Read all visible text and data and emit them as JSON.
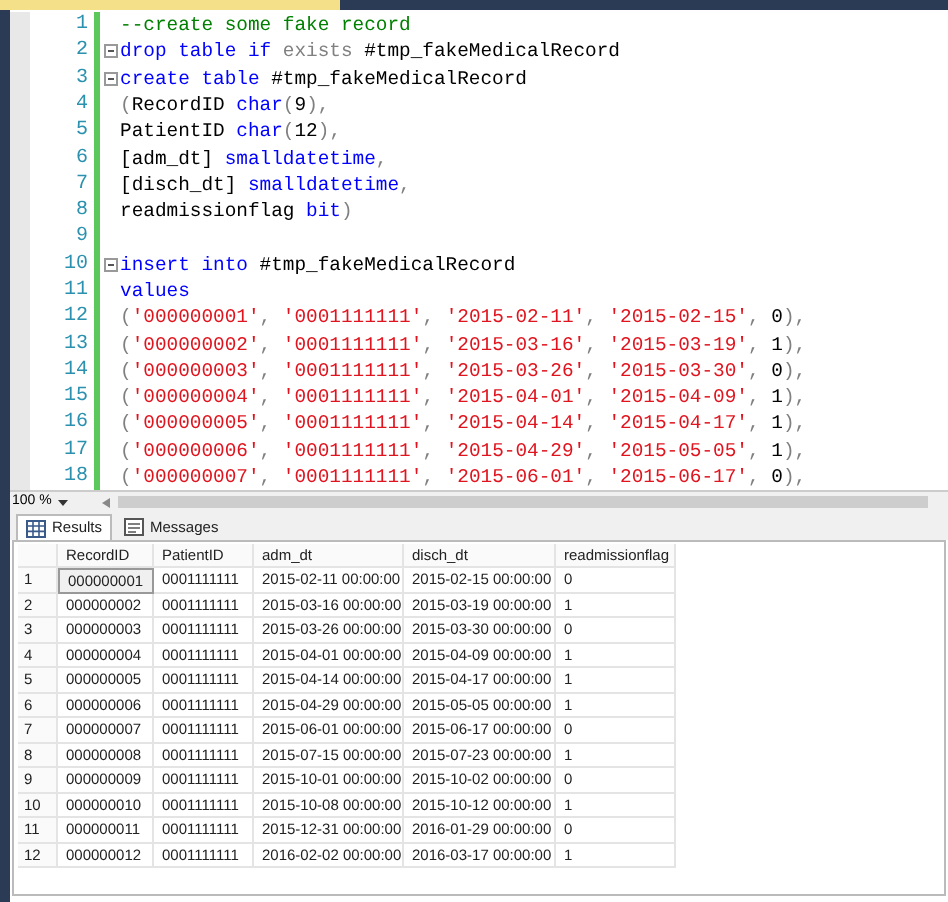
{
  "editor": {
    "lines": [
      {
        "number": "1",
        "collapsible": false,
        "tokens": [
          {
            "kind": "comment",
            "text": "--create some fake record"
          }
        ]
      },
      {
        "number": "2",
        "collapsible": true,
        "tokens": [
          {
            "kind": "keyword",
            "text": "drop table if "
          },
          {
            "kind": "gray",
            "text": "exists"
          },
          {
            "kind": "plain",
            "text": " #tmp_fakeMedicalRecord"
          }
        ]
      },
      {
        "number": "3",
        "collapsible": true,
        "tokens": [
          {
            "kind": "keyword",
            "text": "create table"
          },
          {
            "kind": "plain",
            "text": " #tmp_fakeMedicalRecord"
          }
        ]
      },
      {
        "number": "4",
        "collapsible": false,
        "tokens": [
          {
            "kind": "gray",
            "text": "("
          },
          {
            "kind": "plain",
            "text": "RecordID "
          },
          {
            "kind": "keyword",
            "text": "char"
          },
          {
            "kind": "gray",
            "text": "("
          },
          {
            "kind": "plain",
            "text": "9"
          },
          {
            "kind": "gray",
            "text": "),"
          }
        ]
      },
      {
        "number": "5",
        "collapsible": false,
        "tokens": [
          {
            "kind": "plain",
            "text": "PatientID "
          },
          {
            "kind": "keyword",
            "text": "char"
          },
          {
            "kind": "gray",
            "text": "("
          },
          {
            "kind": "plain",
            "text": "12"
          },
          {
            "kind": "gray",
            "text": "),"
          }
        ]
      },
      {
        "number": "6",
        "collapsible": false,
        "tokens": [
          {
            "kind": "plain",
            "text": "[adm_dt] "
          },
          {
            "kind": "keyword",
            "text": "smalldatetime"
          },
          {
            "kind": "gray",
            "text": ","
          }
        ]
      },
      {
        "number": "7",
        "collapsible": false,
        "tokens": [
          {
            "kind": "plain",
            "text": "[disch_dt] "
          },
          {
            "kind": "keyword",
            "text": "smalldatetime"
          },
          {
            "kind": "gray",
            "text": ","
          }
        ]
      },
      {
        "number": "8",
        "collapsible": false,
        "tokens": [
          {
            "kind": "plain",
            "text": "readmissionflag "
          },
          {
            "kind": "keyword",
            "text": "bit"
          },
          {
            "kind": "gray",
            "text": ")"
          }
        ]
      },
      {
        "number": "9",
        "collapsible": false
      },
      {
        "number": "10",
        "collapsible": true,
        "tokens": [
          {
            "kind": "keyword",
            "text": "insert into"
          },
          {
            "kind": "plain",
            "text": " #tmp_fakeMedicalRecord"
          }
        ]
      },
      {
        "number": "11",
        "collapsible": false,
        "tokens": [
          {
            "kind": "keyword",
            "text": "values"
          }
        ]
      },
      {
        "number": "12",
        "collapsible": false,
        "tokens": [
          {
            "kind": "gray",
            "text": "("
          },
          {
            "kind": "string",
            "text": "'000000001'"
          },
          {
            "kind": "gray",
            "text": ", "
          },
          {
            "kind": "string",
            "text": "'0001111111'"
          },
          {
            "kind": "gray",
            "text": ", "
          },
          {
            "kind": "string",
            "text": "'2015-02-11'"
          },
          {
            "kind": "gray",
            "text": ", "
          },
          {
            "kind": "string",
            "text": "'2015-02-15'"
          },
          {
            "kind": "gray",
            "text": ", "
          },
          {
            "kind": "plain",
            "text": "0"
          },
          {
            "kind": "gray",
            "text": "),"
          }
        ]
      },
      {
        "number": "13",
        "collapsible": false,
        "tokens": [
          {
            "kind": "gray",
            "text": "("
          },
          {
            "kind": "string",
            "text": "'000000002'"
          },
          {
            "kind": "gray",
            "text": ", "
          },
          {
            "kind": "string",
            "text": "'0001111111'"
          },
          {
            "kind": "gray",
            "text": ", "
          },
          {
            "kind": "string",
            "text": "'2015-03-16'"
          },
          {
            "kind": "gray",
            "text": ", "
          },
          {
            "kind": "string",
            "text": "'2015-03-19'"
          },
          {
            "kind": "gray",
            "text": ", "
          },
          {
            "kind": "plain",
            "text": "1"
          },
          {
            "kind": "gray",
            "text": "),"
          }
        ]
      },
      {
        "number": "14",
        "collapsible": false,
        "tokens": [
          {
            "kind": "gray",
            "text": "("
          },
          {
            "kind": "string",
            "text": "'000000003'"
          },
          {
            "kind": "gray",
            "text": ", "
          },
          {
            "kind": "string",
            "text": "'0001111111'"
          },
          {
            "kind": "gray",
            "text": ", "
          },
          {
            "kind": "string",
            "text": "'2015-03-26'"
          },
          {
            "kind": "gray",
            "text": ", "
          },
          {
            "kind": "string",
            "text": "'2015-03-30'"
          },
          {
            "kind": "gray",
            "text": ", "
          },
          {
            "kind": "plain",
            "text": "0"
          },
          {
            "kind": "gray",
            "text": "),"
          }
        ]
      },
      {
        "number": "15",
        "collapsible": false,
        "tokens": [
          {
            "kind": "gray",
            "text": "("
          },
          {
            "kind": "string",
            "text": "'000000004'"
          },
          {
            "kind": "gray",
            "text": ", "
          },
          {
            "kind": "string",
            "text": "'0001111111'"
          },
          {
            "kind": "gray",
            "text": ", "
          },
          {
            "kind": "string",
            "text": "'2015-04-01'"
          },
          {
            "kind": "gray",
            "text": ", "
          },
          {
            "kind": "string",
            "text": "'2015-04-09'"
          },
          {
            "kind": "gray",
            "text": ", "
          },
          {
            "kind": "plain",
            "text": "1"
          },
          {
            "kind": "gray",
            "text": "),"
          }
        ]
      },
      {
        "number": "16",
        "collapsible": false,
        "tokens": [
          {
            "kind": "gray",
            "text": "("
          },
          {
            "kind": "string",
            "text": "'000000005'"
          },
          {
            "kind": "gray",
            "text": ", "
          },
          {
            "kind": "string",
            "text": "'0001111111'"
          },
          {
            "kind": "gray",
            "text": ", "
          },
          {
            "kind": "string",
            "text": "'2015-04-14'"
          },
          {
            "kind": "gray",
            "text": ", "
          },
          {
            "kind": "string",
            "text": "'2015-04-17'"
          },
          {
            "kind": "gray",
            "text": ", "
          },
          {
            "kind": "plain",
            "text": "1"
          },
          {
            "kind": "gray",
            "text": "),"
          }
        ]
      },
      {
        "number": "17",
        "collapsible": false,
        "tokens": [
          {
            "kind": "gray",
            "text": "("
          },
          {
            "kind": "string",
            "text": "'000000006'"
          },
          {
            "kind": "gray",
            "text": ", "
          },
          {
            "kind": "string",
            "text": "'0001111111'"
          },
          {
            "kind": "gray",
            "text": ", "
          },
          {
            "kind": "string",
            "text": "'2015-04-29'"
          },
          {
            "kind": "gray",
            "text": ", "
          },
          {
            "kind": "string",
            "text": "'2015-05-05'"
          },
          {
            "kind": "gray",
            "text": ", "
          },
          {
            "kind": "plain",
            "text": "1"
          },
          {
            "kind": "gray",
            "text": "),"
          }
        ]
      },
      {
        "number": "18",
        "collapsible": false,
        "tokens": [
          {
            "kind": "gray",
            "text": "("
          },
          {
            "kind": "string",
            "text": "'000000007'"
          },
          {
            "kind": "gray",
            "text": ", "
          },
          {
            "kind": "string",
            "text": "'0001111111'"
          },
          {
            "kind": "gray",
            "text": ", "
          },
          {
            "kind": "string",
            "text": "'2015-06-01'"
          },
          {
            "kind": "gray",
            "text": ", "
          },
          {
            "kind": "string",
            "text": "'2015-06-17'"
          },
          {
            "kind": "gray",
            "text": ", "
          },
          {
            "kind": "plain",
            "text": "0"
          },
          {
            "kind": "gray",
            "text": "),"
          }
        ]
      }
    ]
  },
  "zoom": {
    "value": "100 %"
  },
  "result_tabs": [
    {
      "label": "Results",
      "kind": "grid",
      "selected": true
    },
    {
      "label": "Messages",
      "kind": "messages",
      "selected": false
    }
  ],
  "table": {
    "columns": [
      "RecordID",
      "PatientID",
      "adm_dt",
      "disch_dt",
      "readmissionflag"
    ],
    "rows": [
      {
        "number": "1",
        "selected": true,
        "cells": [
          "000000001",
          "0001111111",
          "2015-02-11 00:00:00",
          "2015-02-15 00:00:00",
          "0"
        ]
      },
      {
        "number": "2",
        "selected": false,
        "cells": [
          "000000002",
          "0001111111",
          "2015-03-16 00:00:00",
          "2015-03-19 00:00:00",
          "1"
        ]
      },
      {
        "number": "3",
        "selected": false,
        "cells": [
          "000000003",
          "0001111111",
          "2015-03-26 00:00:00",
          "2015-03-30 00:00:00",
          "0"
        ]
      },
      {
        "number": "4",
        "selected": false,
        "cells": [
          "000000004",
          "0001111111",
          "2015-04-01 00:00:00",
          "2015-04-09 00:00:00",
          "1"
        ]
      },
      {
        "number": "5",
        "selected": false,
        "cells": [
          "000000005",
          "0001111111",
          "2015-04-14 00:00:00",
          "2015-04-17 00:00:00",
          "1"
        ]
      },
      {
        "number": "6",
        "selected": false,
        "cells": [
          "000000006",
          "0001111111",
          "2015-04-29 00:00:00",
          "2015-05-05 00:00:00",
          "1"
        ]
      },
      {
        "number": "7",
        "selected": false,
        "cells": [
          "000000007",
          "0001111111",
          "2015-06-01 00:00:00",
          "2015-06-17 00:00:00",
          "0"
        ]
      },
      {
        "number": "8",
        "selected": false,
        "cells": [
          "000000008",
          "0001111111",
          "2015-07-15 00:00:00",
          "2015-07-23 00:00:00",
          "1"
        ]
      },
      {
        "number": "9",
        "selected": false,
        "cells": [
          "000000009",
          "0001111111",
          "2015-10-01 00:00:00",
          "2015-10-02 00:00:00",
          "0"
        ]
      },
      {
        "number": "10",
        "selected": false,
        "cells": [
          "000000010",
          "0001111111",
          "2015-10-08 00:00:00",
          "2015-10-12 00:00:00",
          "1"
        ]
      },
      {
        "number": "11",
        "selected": false,
        "cells": [
          "000000011",
          "0001111111",
          "2015-12-31 00:00:00",
          "2016-01-29 00:00:00",
          "0"
        ]
      },
      {
        "number": "12",
        "selected": false,
        "cells": [
          "000000012",
          "0001111111",
          "2016-02-02 00:00:00",
          "2016-03-17 00:00:00",
          "1"
        ]
      }
    ]
  }
}
